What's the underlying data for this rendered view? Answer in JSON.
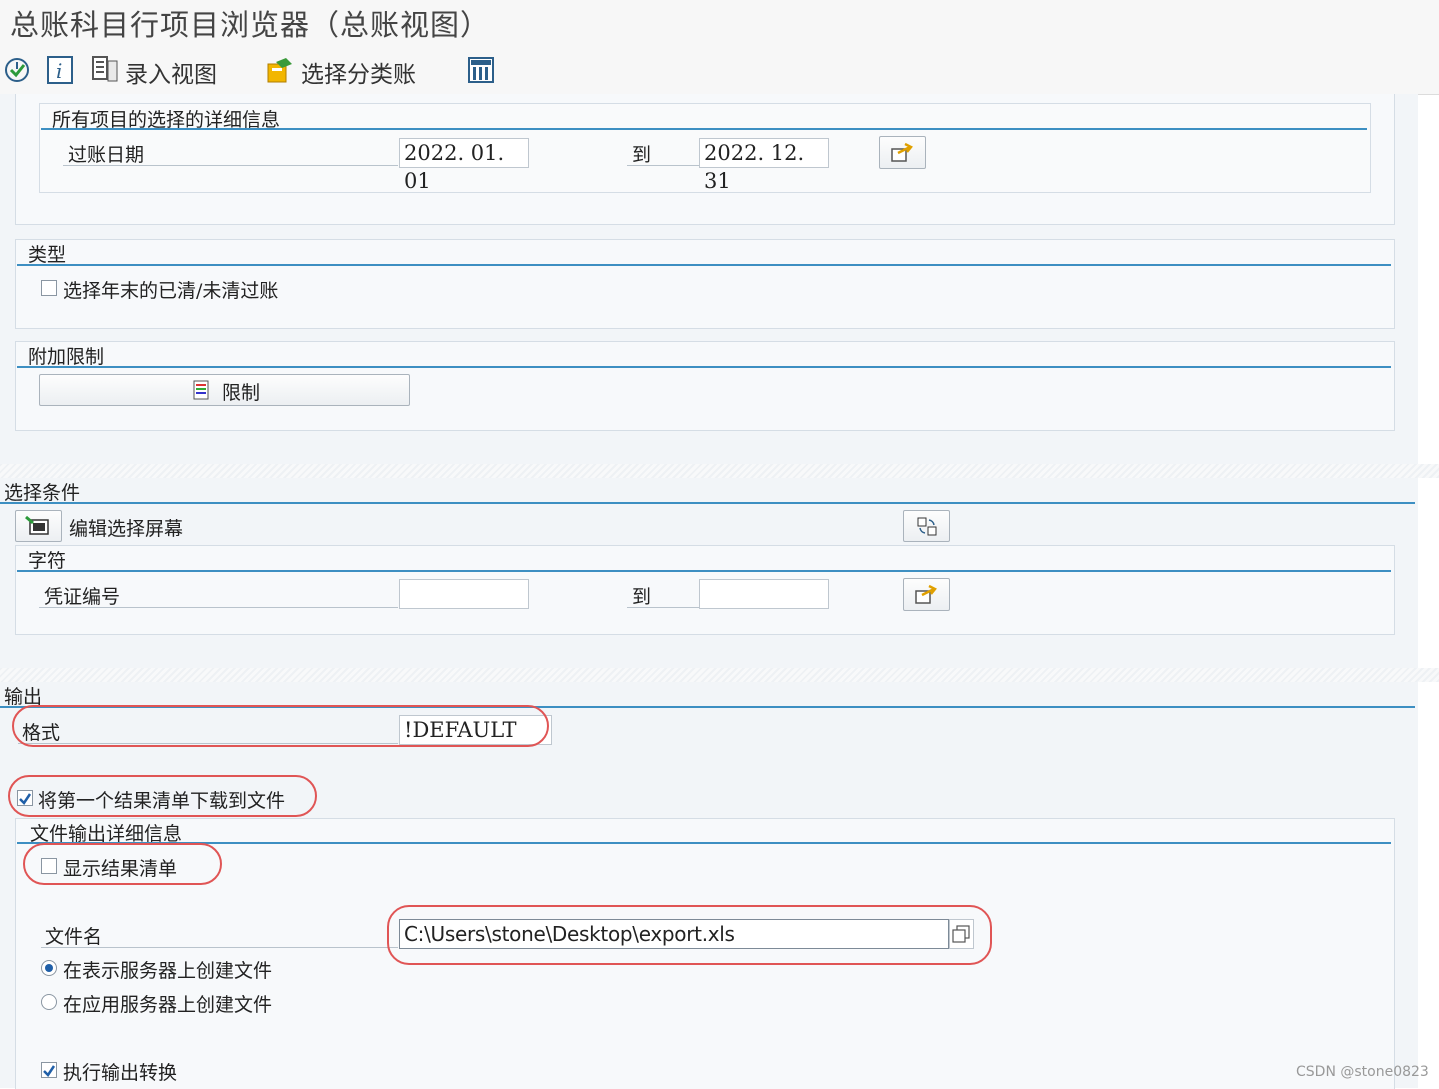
{
  "window": {
    "title": "总账科目行项目浏览器（总账视图）"
  },
  "toolbar": {
    "entry_view_label": "录入视图",
    "select_ledger_label": "选择分类账"
  },
  "sections": {
    "all_items": {
      "title": "所有项目的选择的详细信息",
      "posting_date_label": "过账日期",
      "from_value": "2022. 01. 01",
      "to_label": "到",
      "to_value": "2022. 12. 31"
    },
    "type": {
      "title": "类型",
      "checkbox_label": "选择年末的已清/未清过账",
      "checked": false
    },
    "restrictions": {
      "title": "附加限制",
      "button_label": "限制"
    },
    "selection": {
      "title": "选择条件",
      "edit_screen_label": "编辑选择屏幕",
      "char_title": "字符",
      "doc_number_label": "凭证编号",
      "to_label": "到",
      "from_value": "",
      "to_value": ""
    },
    "output": {
      "title": "输出",
      "format_label": "格式",
      "format_value": "!DEFAULT",
      "download_label": "将第一个结果清单下载到文件",
      "download_checked": true,
      "file_details_title": "文件输出详细信息",
      "show_result_label": "显示结果清单",
      "show_result_checked": false,
      "filename_label": "文件名",
      "filename_value": "C:\\Users\\stone\\Desktop\\export.xls",
      "radio_presentation_label": "在表示服务器上创建文件",
      "radio_application_label": "在应用服务器上创建文件",
      "selected_radio": "presentation",
      "convert_label": "执行输出转换",
      "convert_checked": true
    }
  },
  "watermark": "CSDN @stone0823",
  "colors": {
    "accent_line": "#3d8fc2",
    "highlight": "#e05555"
  }
}
